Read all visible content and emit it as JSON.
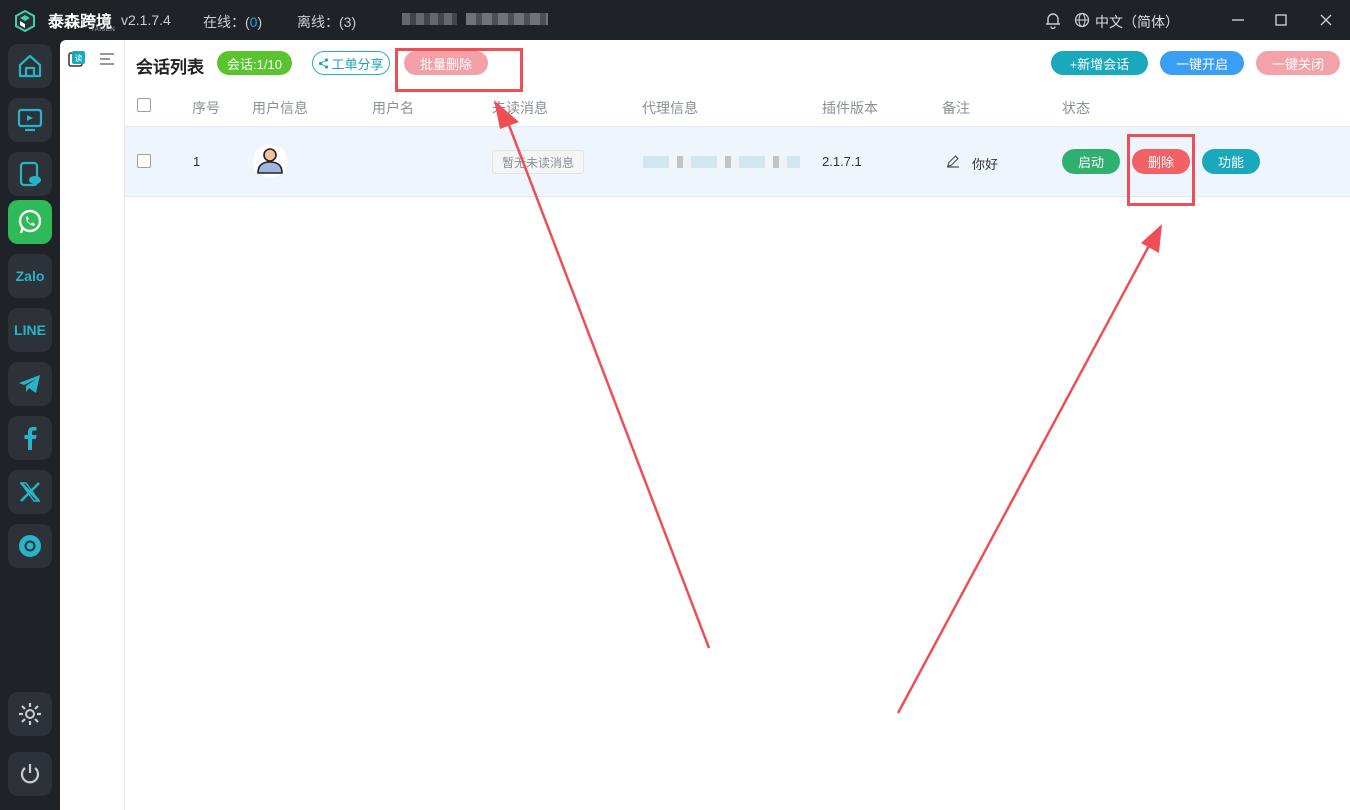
{
  "titlebar": {
    "app_name": "泰森跨境",
    "app_sub": "TAISEN",
    "version": "v2.1.7.4",
    "online_label": "在线：(",
    "online_count": "0",
    "online_close": ")",
    "offline_label": "离线：(3)",
    "language": "中文（简体）"
  },
  "sidebar": {
    "items": [
      {
        "name": "home",
        "icon": "home-icon"
      },
      {
        "name": "monitor",
        "icon": "monitor-icon"
      },
      {
        "name": "cloud-phone",
        "icon": "cloud-phone-icon"
      },
      {
        "name": "whatsapp",
        "icon": "whatsapp-icon",
        "active": true
      },
      {
        "name": "zalo",
        "label": "Zalo"
      },
      {
        "name": "line",
        "label": "LINE"
      },
      {
        "name": "telegram",
        "icon": "telegram-icon"
      },
      {
        "name": "facebook",
        "icon": "facebook-icon"
      },
      {
        "name": "x",
        "icon": "x-icon"
      },
      {
        "name": "chrome",
        "icon": "chrome-icon"
      }
    ]
  },
  "panel": {
    "title": "会话列表",
    "session_badge": "会话:1/10",
    "share_label": "工单分享",
    "batch_delete_label": "批量删除",
    "new_session_label": "+新增会话",
    "start_all_label": "一键开启",
    "close_all_label": "一键关闭"
  },
  "table": {
    "headers": [
      "序号",
      "用户信息",
      "用户名",
      "未读消息",
      "代理信息",
      "插件版本",
      "备注",
      "状态"
    ],
    "rows": [
      {
        "index": "1",
        "username": "",
        "unread": "暂无未读消息",
        "plugin_version": "2.1.7.1",
        "remark": "你好",
        "start_label": "启动",
        "delete_label": "删除",
        "function_label": "功能"
      }
    ]
  },
  "colors": {
    "accent": "#1aa8bd",
    "green": "#5ac42f",
    "danger": "#f26165",
    "annotation": "#ee4f55"
  }
}
